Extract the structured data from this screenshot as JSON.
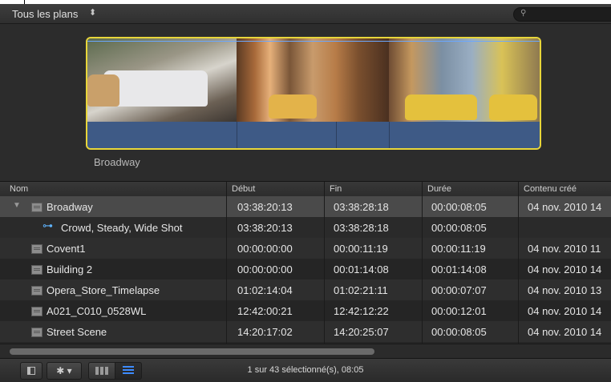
{
  "toolbar": {
    "filter_label": "Tous les plans",
    "filter_arrow": "⬍",
    "search_icon": "search-icon"
  },
  "filmstrip": {
    "clip_name": "Broadway",
    "highlight_color": "#e8d63a"
  },
  "table": {
    "columns": [
      "Nom",
      "Début",
      "Fin",
      "Durée",
      "Contenu créé"
    ],
    "rows": [
      {
        "name": "Broadway",
        "debut": "03:38:20:13",
        "fin": "03:38:28:18",
        "duree": "00:00:08:05",
        "cree": "04 nov. 2010 14",
        "selected": true,
        "expanded": true
      },
      {
        "name": "Crowd, Steady, Wide Shot",
        "debut": "03:38:20:13",
        "fin": "03:38:28:18",
        "duree": "00:00:08:05",
        "cree": "",
        "keyword": true
      },
      {
        "name": "Covent1",
        "debut": "00:00:00:00",
        "fin": "00:00:11:19",
        "duree": "00:00:11:19",
        "cree": "04 nov. 2010 11"
      },
      {
        "name": "Building 2",
        "debut": "00:00:00:00",
        "fin": "00:01:14:08",
        "duree": "00:01:14:08",
        "cree": "04 nov. 2010 14"
      },
      {
        "name": "Opera_Store_Timelapse",
        "debut": "01:02:14:04",
        "fin": "01:02:21:11",
        "duree": "00:00:07:07",
        "cree": "04 nov. 2010 13"
      },
      {
        "name": "A021_C010_0528WL",
        "debut": "12:42:00:21",
        "fin": "12:42:12:22",
        "duree": "00:00:12:01",
        "cree": "04 nov. 2010 14"
      },
      {
        "name": "Street Scene",
        "debut": "14:20:17:02",
        "fin": "14:20:25:07",
        "duree": "00:00:08:05",
        "cree": "04 nov. 2010 14"
      }
    ]
  },
  "bottom": {
    "status": "1 sur 43 sélectionné(s), 08:05",
    "gear_label": "✱ ▾",
    "accent_color": "#3d8bff"
  }
}
